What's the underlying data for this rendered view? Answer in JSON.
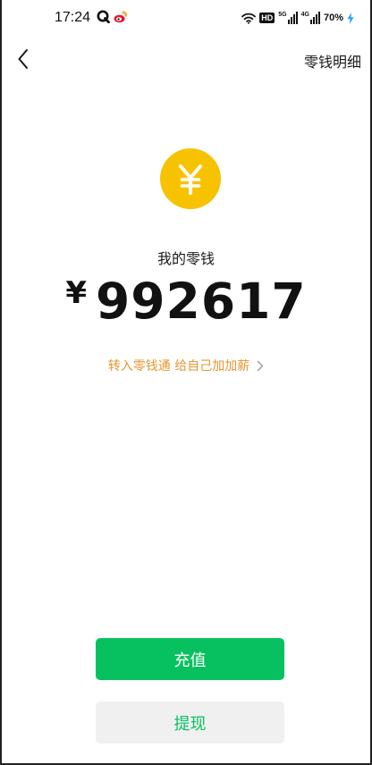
{
  "status_bar": {
    "time": "17:24",
    "notifications": [
      "q-app-icon",
      "weibo-icon"
    ],
    "hd_label": "HD",
    "signal1_label": "5G",
    "signal2_label": "4G",
    "battery": "70%"
  },
  "nav": {
    "back_icon": "chevron-left-icon",
    "details_label": "零钱明细"
  },
  "wallet": {
    "coin_icon": "yuan-coin-icon",
    "balance_label": "我的零钱",
    "currency_symbol": "¥",
    "balance": "992617",
    "promo_text": "转入零钱通 给自己加加薪",
    "promo_icon": "chevron-right-icon"
  },
  "actions": {
    "topup_label": "充值",
    "withdraw_label": "提现"
  },
  "colors": {
    "primary_green": "#07c160",
    "coin_yellow": "#f7c300",
    "promo_orange": "#e8962f",
    "secondary_button_bg": "#f0f0f0"
  }
}
